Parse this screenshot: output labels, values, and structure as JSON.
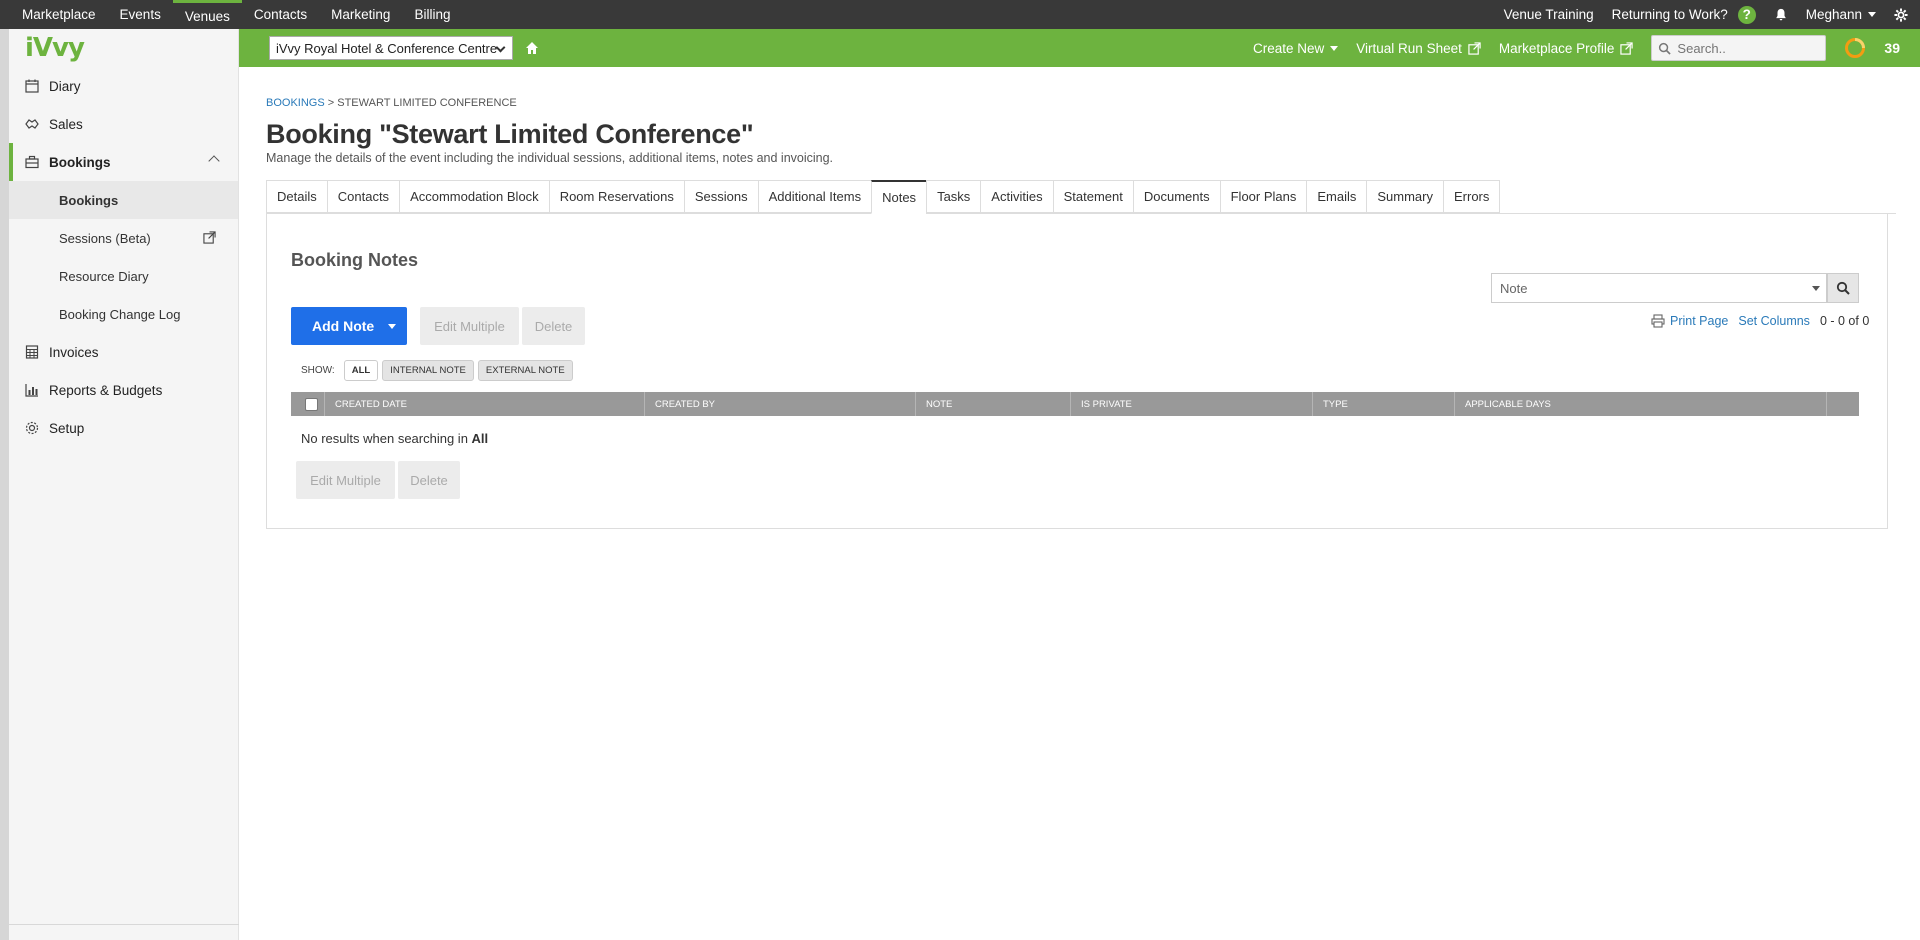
{
  "top_nav": {
    "items": [
      "Marketplace",
      "Events",
      "Venues",
      "Contacts",
      "Marketing",
      "Billing"
    ],
    "active": "Venues",
    "right": {
      "venue_training": "Venue Training",
      "returning": "Returning to Work?",
      "help": "?",
      "user": "Meghann"
    }
  },
  "sidebar": {
    "logo": "iVvy",
    "items": [
      {
        "label": "Diary",
        "icon": "calendar-icon"
      },
      {
        "label": "Sales",
        "icon": "handshake-icon"
      },
      {
        "label": "Bookings",
        "icon": "briefcase-icon"
      }
    ],
    "sub_items": [
      "Bookings",
      "Sessions (Beta)",
      "Resource Diary",
      "Booking Change Log"
    ],
    "bottom_items": [
      {
        "label": "Invoices",
        "icon": "calculator-icon"
      },
      {
        "label": "Reports & Budgets",
        "icon": "bar-chart-icon"
      },
      {
        "label": "Setup",
        "icon": "gear-icon"
      }
    ]
  },
  "greenbar": {
    "venue": "iVvy Royal Hotel & Conference Centre",
    "create_new": "Create New",
    "virtual_run_sheet": "Virtual Run Sheet",
    "marketplace_profile": "Marketplace Profile",
    "search_placeholder": "Search..",
    "count": "39",
    "accent": "#6db33f"
  },
  "breadcrumb": {
    "link": "BOOKINGS",
    "sep": ">",
    "current": "STEWART LIMITED CONFERENCE"
  },
  "page": {
    "title": "Booking \"Stewart Limited Conference\"",
    "description": "Manage the details of the event including the individual sessions, additional items, notes and invoicing."
  },
  "tabs": [
    "Details",
    "Contacts",
    "Accommodation Block",
    "Room Reservations",
    "Sessions",
    "Additional Items",
    "Notes",
    "Tasks",
    "Activities",
    "Statement",
    "Documents",
    "Floor Plans",
    "Emails",
    "Summary",
    "Errors"
  ],
  "active_tab": "Notes",
  "notes": {
    "title": "Booking Notes",
    "filter_value": "Note",
    "print_page": "Print Page",
    "set_columns": "Set Columns",
    "record_count": "0 - 0 of 0",
    "add_note": "Add Note",
    "edit_multiple": "Edit Multiple",
    "delete": "Delete",
    "show_label": "SHOW:",
    "filters": [
      "ALL",
      "INTERNAL NOTE",
      "EXTERNAL NOTE"
    ],
    "columns": [
      "CREATED DATE",
      "CREATED BY",
      "NOTE",
      "IS PRIVATE",
      "TYPE",
      "APPLICABLE DAYS"
    ],
    "no_results": "No results when searching in",
    "no_results_scope": "All"
  }
}
